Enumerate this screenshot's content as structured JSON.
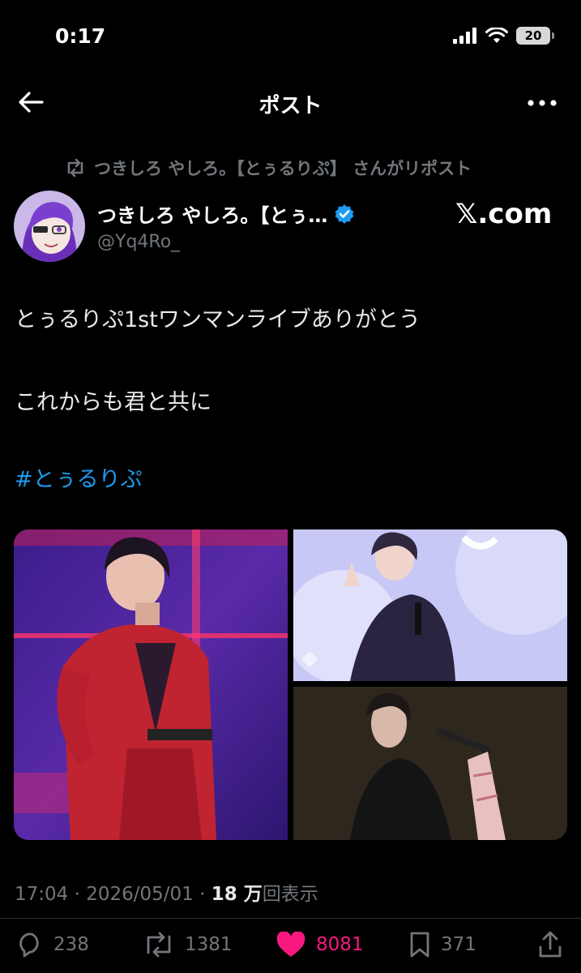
{
  "status_bar": {
    "time": "0:17",
    "battery": "20"
  },
  "nav": {
    "title": "ポスト"
  },
  "repost": {
    "text": "つきしろ やしろ。【とぅるりぷ】 さんがリポスト"
  },
  "author": {
    "name": "つきしろ やしろ。【とぅ…",
    "handle": "@Yq4Ro_",
    "verified": true
  },
  "watermark": "𝕏.com",
  "post": {
    "line1": "とぅるりぷ1stワンマンライブありがとう",
    "line2": "これからも君と共に",
    "hashtag": "#とぅるりぷ"
  },
  "meta": {
    "time": "17:04",
    "date": "2026/05/01",
    "views_count": "18 万",
    "views_label": "回表示"
  },
  "actions": {
    "replies": "238",
    "reposts": "1381",
    "likes": "8081",
    "bookmarks": "371"
  },
  "colors": {
    "accent": "#1d9bf0",
    "like": "#f91880",
    "muted": "#71767b"
  }
}
